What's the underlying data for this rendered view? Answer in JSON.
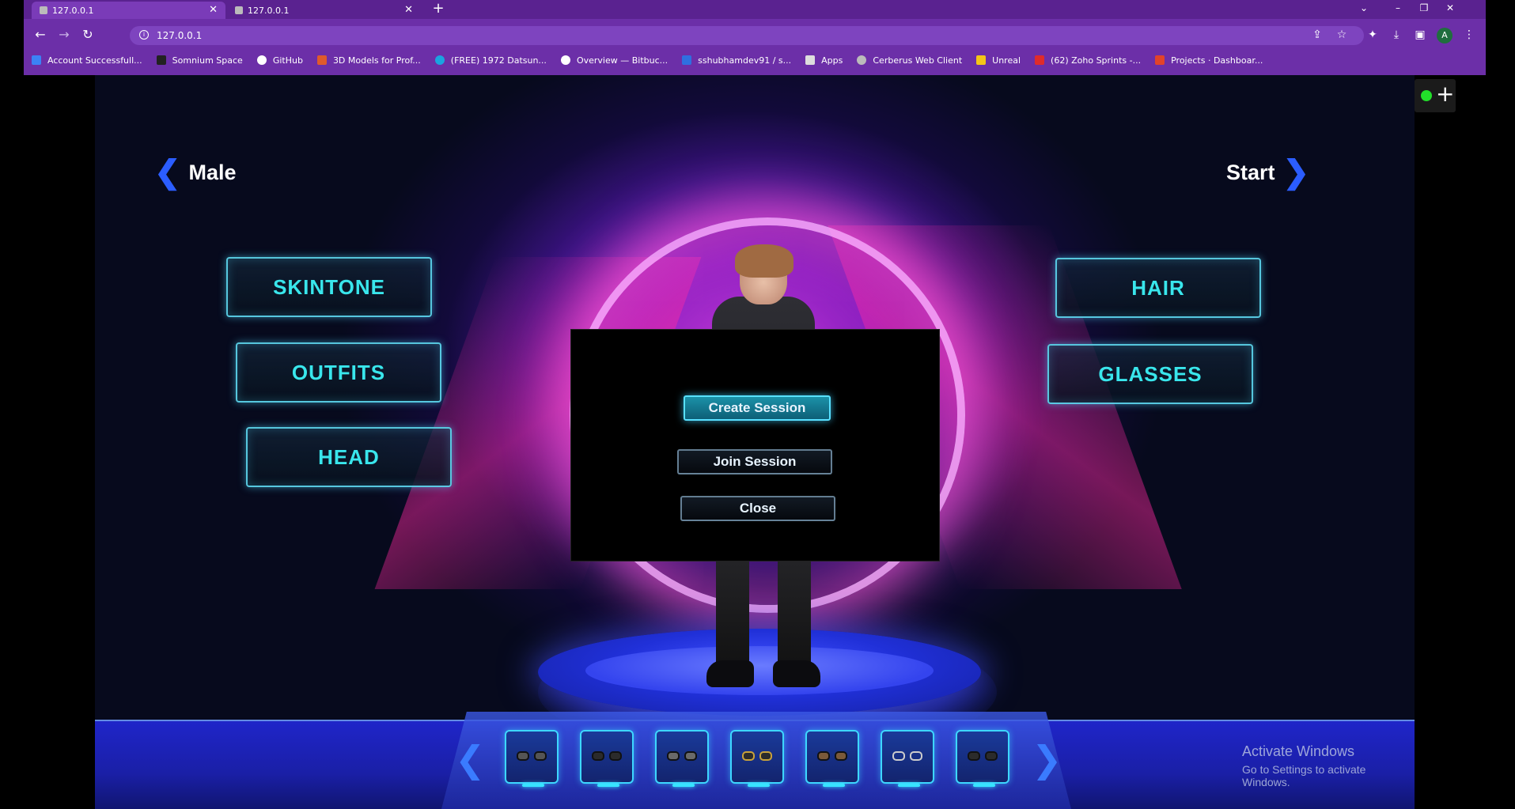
{
  "browser": {
    "tabs": [
      {
        "title": "127.0.0.1",
        "active": true
      },
      {
        "title": "127.0.0.1",
        "active": false
      }
    ],
    "url": "127.0.0.1",
    "avatar_initial": "A",
    "bookmarks": [
      {
        "label": "Account Successfull...",
        "color": "#3b82f6"
      },
      {
        "label": "Somnium Space",
        "color": "#222222"
      },
      {
        "label": "GitHub",
        "color": "#ffffff"
      },
      {
        "label": "3D Models for Prof...",
        "color": "#e05a2b"
      },
      {
        "label": "(FREE) 1972 Datsun...",
        "color": "#1ba3e0"
      },
      {
        "label": "Overview — Bitbuc...",
        "color": "#ffffff"
      },
      {
        "label": "sshubhamdev91 / s...",
        "color": "#2f6fe0"
      },
      {
        "label": "Apps",
        "color": "#dddddd"
      },
      {
        "label": "Cerberus Web Client",
        "color": "#bbbbbb"
      },
      {
        "label": "Unreal",
        "color": "#f5c518"
      },
      {
        "label": "(62) Zoho Sprints -...",
        "color": "#e02b2b"
      },
      {
        "label": "Projects · Dashboar...",
        "color": "#e2432a"
      }
    ]
  },
  "game": {
    "nav_left": "Male",
    "nav_right": "Start",
    "left_menu": [
      "SKINTONE",
      "OUTFITS",
      "HEAD"
    ],
    "right_menu": [
      "HAIR",
      "GLASSES"
    ],
    "dialog": {
      "create": "Create Session",
      "join": "Join Session",
      "close": "Close"
    },
    "carousel_slots": 7
  },
  "windows_notice": {
    "title": "Activate Windows",
    "subtitle": "Go to Settings to activate Windows."
  }
}
